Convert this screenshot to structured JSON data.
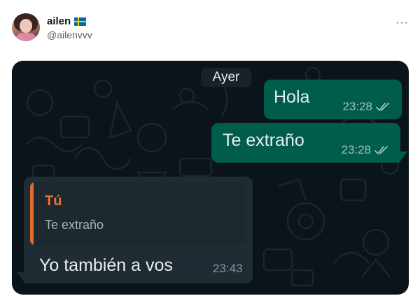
{
  "post": {
    "author_name": "ailen",
    "author_handle": "@ailenvvv",
    "flag_icon": "sweden-flag-icon",
    "more_label": "···"
  },
  "chat": {
    "day_label": "Ayer",
    "colors": {
      "background": "#0b141a",
      "outgoing_bubble": "#005c4b",
      "incoming_bubble": "#202c33",
      "quote_accent": "#e26a2c"
    },
    "messages": [
      {
        "direction": "outgoing",
        "text": "Hola",
        "time": "23:28",
        "status": "read-double-check-icon"
      },
      {
        "direction": "outgoing",
        "text": "Te extraño",
        "time": "23:28",
        "status": "read-double-check-icon"
      },
      {
        "direction": "incoming",
        "quote": {
          "author": "Tú",
          "text": "Te extraño"
        },
        "text": "Yo también a vos",
        "time": "23:43"
      }
    ]
  }
}
